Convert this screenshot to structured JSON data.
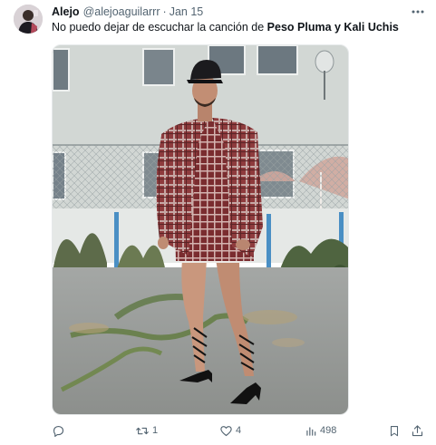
{
  "author": {
    "display_name": "Alejo",
    "handle": "@alejoaguilarrr",
    "separator": "·",
    "timestamp": "Jan 15"
  },
  "tweet": {
    "text_prefix": "No puedo dejar de escuchar la canción de ",
    "text_bold": "Peso Pluma y Kali Uchis"
  },
  "actions": {
    "reply_count": "",
    "retweet_count": "1",
    "like_count": "4",
    "views_count": "498"
  },
  "icons": {
    "more": "more-horizontal-icon",
    "reply": "reply-icon",
    "retweet": "retweet-icon",
    "like": "heart-icon",
    "views": "views-chart-icon",
    "bookmark": "bookmark-icon",
    "share": "share-icon"
  },
  "colors": {
    "text_primary": "#0f1419",
    "text_secondary": "#536471"
  }
}
